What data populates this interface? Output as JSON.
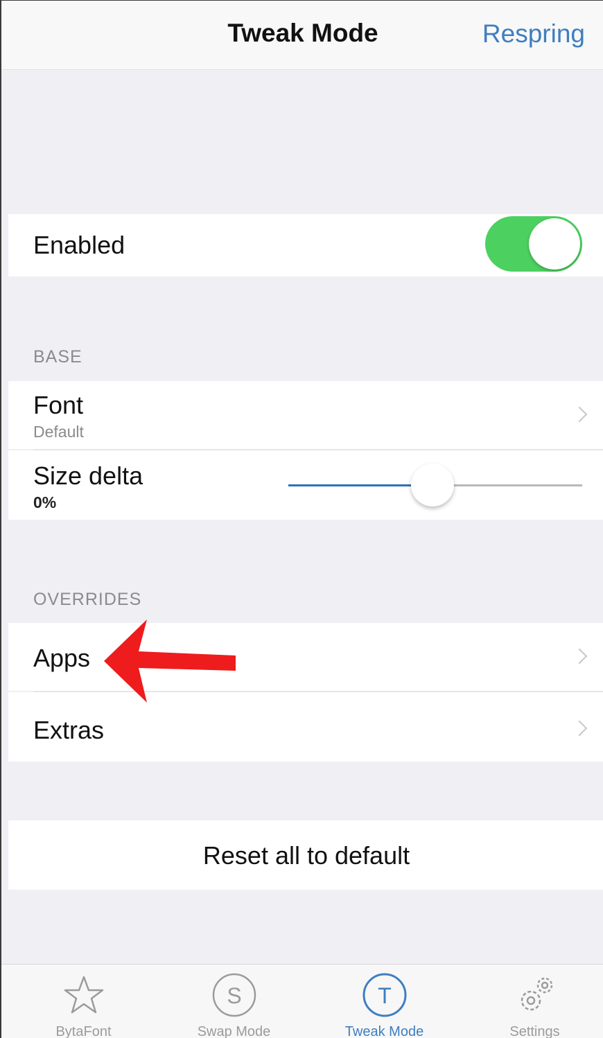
{
  "navbar": {
    "title": "Tweak Mode",
    "right_button": "Respring"
  },
  "enabled": {
    "label": "Enabled",
    "on": true
  },
  "base": {
    "header": "BASE",
    "font": {
      "title": "Font",
      "subtitle": "Default"
    },
    "size_delta": {
      "title": "Size delta",
      "value_text": "0%",
      "slider_level": 0.49
    }
  },
  "overrides": {
    "header": "OVERRIDES",
    "items": [
      {
        "label": "Apps"
      },
      {
        "label": "Extras"
      }
    ]
  },
  "reset": {
    "label": "Reset all to default"
  },
  "tabbar": {
    "tabs": [
      {
        "label": "BytaFont",
        "icon": "star-icon"
      },
      {
        "label": "Swap Mode",
        "icon": "s-circle-icon"
      },
      {
        "label": "Tweak Mode",
        "icon": "t-circle-icon",
        "active": true
      },
      {
        "label": "Settings",
        "icon": "gears-icon"
      }
    ]
  },
  "colors": {
    "accent": "#3f7ec0",
    "toggle_on": "#4cd060",
    "annotation_arrow": "#ee1c1c"
  }
}
